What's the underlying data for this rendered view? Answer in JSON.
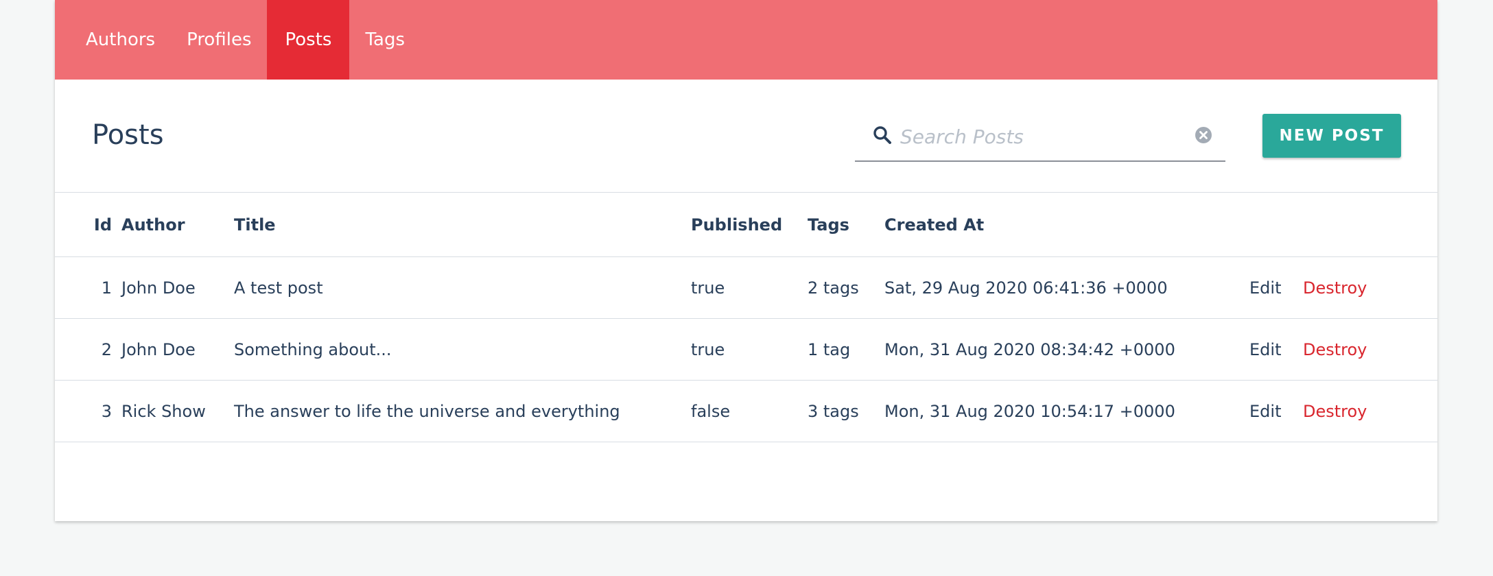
{
  "nav": {
    "items": [
      {
        "label": "Authors",
        "active": false
      },
      {
        "label": "Profiles",
        "active": false
      },
      {
        "label": "Posts",
        "active": true
      },
      {
        "label": "Tags",
        "active": false
      }
    ]
  },
  "page": {
    "title": "Posts"
  },
  "search": {
    "placeholder": "Search Posts",
    "value": "",
    "icon": "search-icon",
    "clear_icon": "clear-icon"
  },
  "toolbar": {
    "new_label": "NEW POST"
  },
  "table": {
    "headers": {
      "id": "Id",
      "author": "Author",
      "title": "Title",
      "published": "Published",
      "tags": "Tags",
      "created_at": "Created At"
    },
    "rows": [
      {
        "id": "1",
        "author": "John Doe",
        "title": "A test post",
        "published": "true",
        "tags": "2 tags",
        "created_at": "Sat, 29 Aug 2020 06:41:36 +0000",
        "edit": "Edit",
        "destroy": "Destroy"
      },
      {
        "id": "2",
        "author": "John Doe",
        "title": "Something about...",
        "published": "true",
        "tags": "1 tag",
        "created_at": "Mon, 31 Aug 2020 08:34:42 +0000",
        "edit": "Edit",
        "destroy": "Destroy"
      },
      {
        "id": "3",
        "author": "Rick Show",
        "title": "The answer to life the universe and everything",
        "published": "false",
        "tags": "3 tags",
        "created_at": "Mon, 31 Aug 2020 10:54:17 +0000",
        "edit": "Edit",
        "destroy": "Destroy"
      }
    ]
  },
  "colors": {
    "navbar": "#f06e74",
    "navbar_active": "#e52b35",
    "primary_button": "#2aa89a",
    "destroy_text": "#d9262e",
    "text": "#293f5a"
  }
}
